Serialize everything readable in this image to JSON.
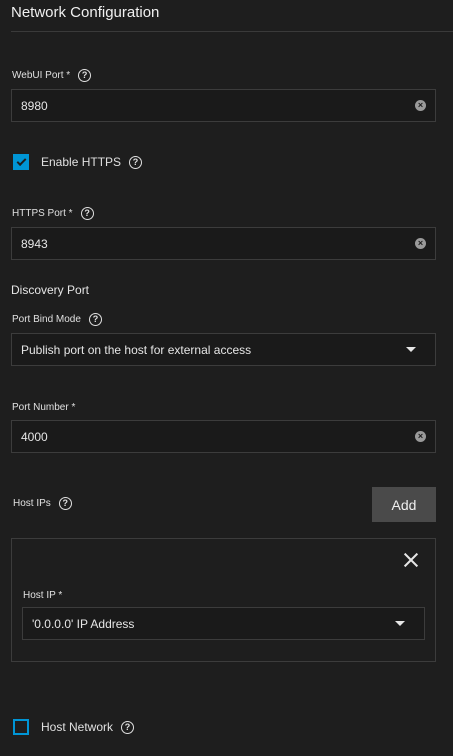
{
  "section": {
    "title": "Network Configuration"
  },
  "webui_port": {
    "label": "WebUI Port *",
    "value": "8980"
  },
  "enable_https": {
    "label": "Enable HTTPS",
    "checked": true
  },
  "https_port": {
    "label": "HTTPS Port *",
    "value": "8943"
  },
  "discovery": {
    "heading": "Discovery Port",
    "bind_mode_label": "Port Bind Mode",
    "bind_mode_value": "Publish port on the host for external access",
    "port_number_label": "Port Number *",
    "port_number_value": "4000"
  },
  "host_ips": {
    "label": "Host IPs",
    "add_label": "Add",
    "item": {
      "label": "Host IP *",
      "value": "'0.0.0.0' IP Address"
    }
  },
  "host_network": {
    "label": "Host Network",
    "checked": false
  },
  "colors": {
    "accent": "#0095d5",
    "background": "#1e1e1e",
    "button": "#4a4a4a"
  },
  "icons": [
    "help-icon",
    "clear-icon",
    "check-icon",
    "chevron-down-icon",
    "close-icon"
  ]
}
